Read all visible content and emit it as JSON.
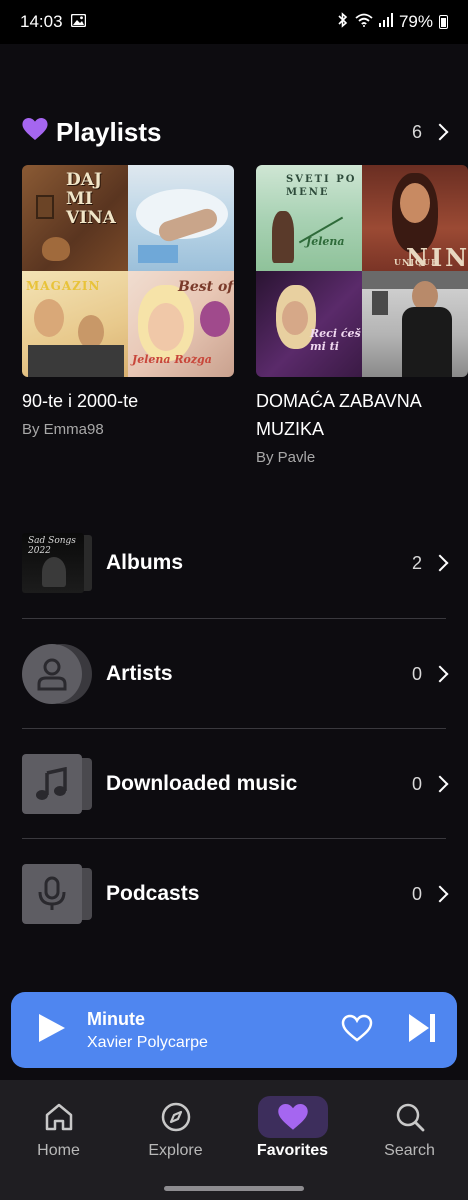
{
  "status_bar": {
    "time": "14:03",
    "battery": "79%"
  },
  "playlists": {
    "title": "Playlists",
    "count": "6",
    "items": [
      {
        "title": "90-te i 2000-te",
        "author": "By Emma98",
        "cover_texts": [
          "DAJ MI VINA",
          "MAGAZIN",
          "Best of",
          "Jelena Rozga"
        ]
      },
      {
        "title": "DOMAĆA ZABAVNA MUZIKA",
        "author": "By Pavle",
        "cover_texts": [
          "SVETI PO MENE",
          "Jelena",
          "NINA",
          "UNIQUE",
          "Reci ćeš mi ti"
        ]
      }
    ]
  },
  "library": {
    "albums": {
      "label": "Albums",
      "count": "2",
      "thumb_text": "Sad Songs 2022"
    },
    "artists": {
      "label": "Artists",
      "count": "0"
    },
    "downloaded": {
      "label": "Downloaded music",
      "count": "0"
    },
    "podcasts": {
      "label": "Podcasts",
      "count": "0"
    }
  },
  "player": {
    "title": "Minute",
    "artist": "Xavier Polycarpe",
    "accent_color": "#4f86f0"
  },
  "nav": {
    "home": "Home",
    "explore": "Explore",
    "favorites": "Favorites",
    "search": "Search",
    "active": "favorites",
    "active_color": "#a566f0"
  }
}
